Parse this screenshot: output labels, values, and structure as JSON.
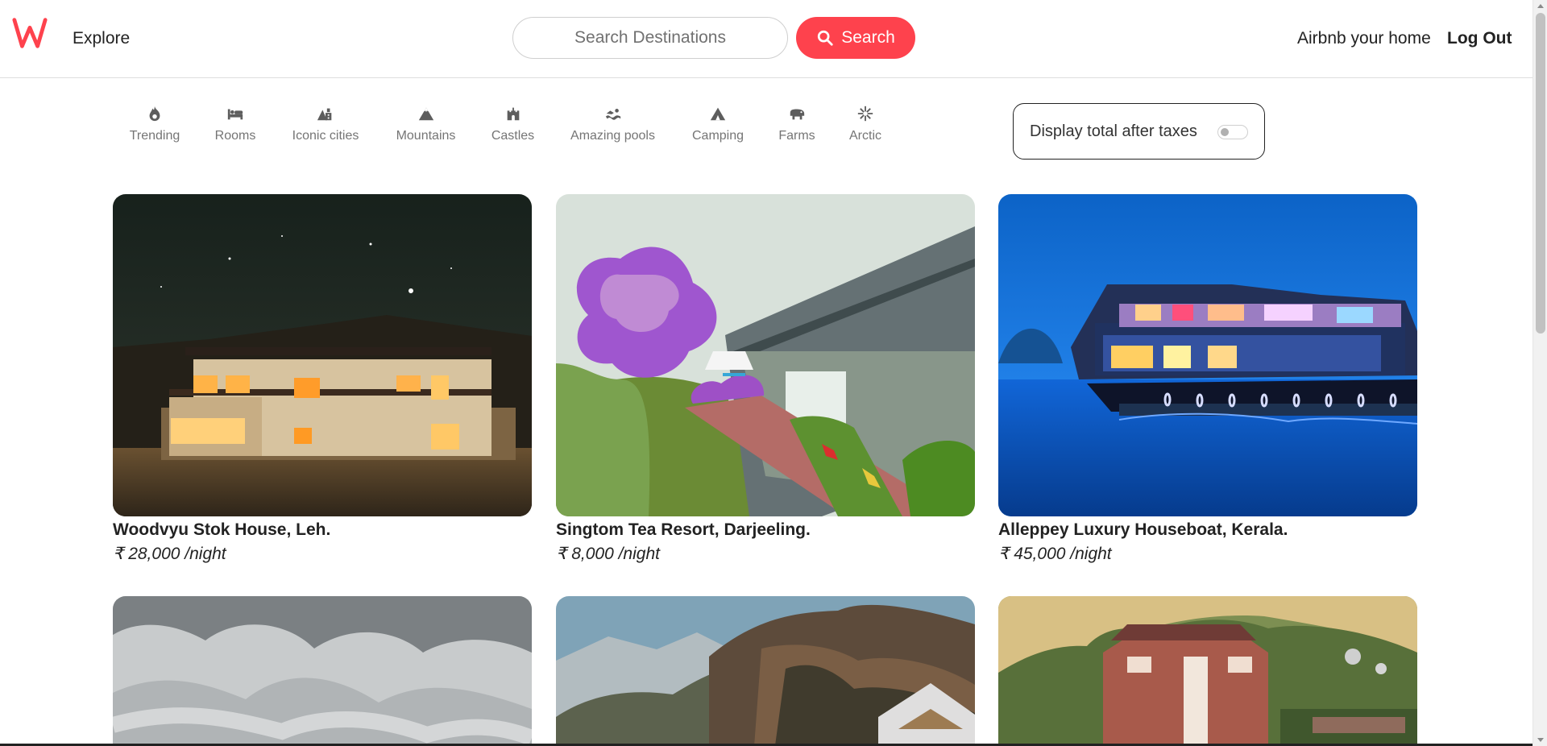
{
  "brand": {
    "logo_icon": "wanderlust-logo-icon",
    "accent_color": "#fe424d"
  },
  "header": {
    "explore": "Explore",
    "search_placeholder": "Search Destinations",
    "search_button": "Search",
    "host_link": "Airbnb your home",
    "logout": "Log Out"
  },
  "filters": [
    {
      "label": "Trending",
      "icon": "fire-icon"
    },
    {
      "label": "Rooms",
      "icon": "bed-icon"
    },
    {
      "label": "Iconic cities",
      "icon": "city-icon"
    },
    {
      "label": "Mountains",
      "icon": "mountain-icon"
    },
    {
      "label": "Castles",
      "icon": "castle-icon"
    },
    {
      "label": "Amazing pools",
      "icon": "pool-icon"
    },
    {
      "label": "Camping",
      "icon": "campground-icon"
    },
    {
      "label": "Farms",
      "icon": "cow-icon"
    },
    {
      "label": "Arctic",
      "icon": "snowflake-icon"
    }
  ],
  "tax_toggle": {
    "label": "Display total after taxes",
    "enabled": false
  },
  "listings": [
    {
      "title": "Woodvyu Stok House, Leh.",
      "price": "₹ 28,000 /night"
    },
    {
      "title": "Singtom Tea Resort, Darjeeling.",
      "price": "₹ 8,000 /night"
    },
    {
      "title": "Alleppey Luxury Houseboat, Kerala.",
      "price": "₹ 45,000 /night"
    }
  ]
}
